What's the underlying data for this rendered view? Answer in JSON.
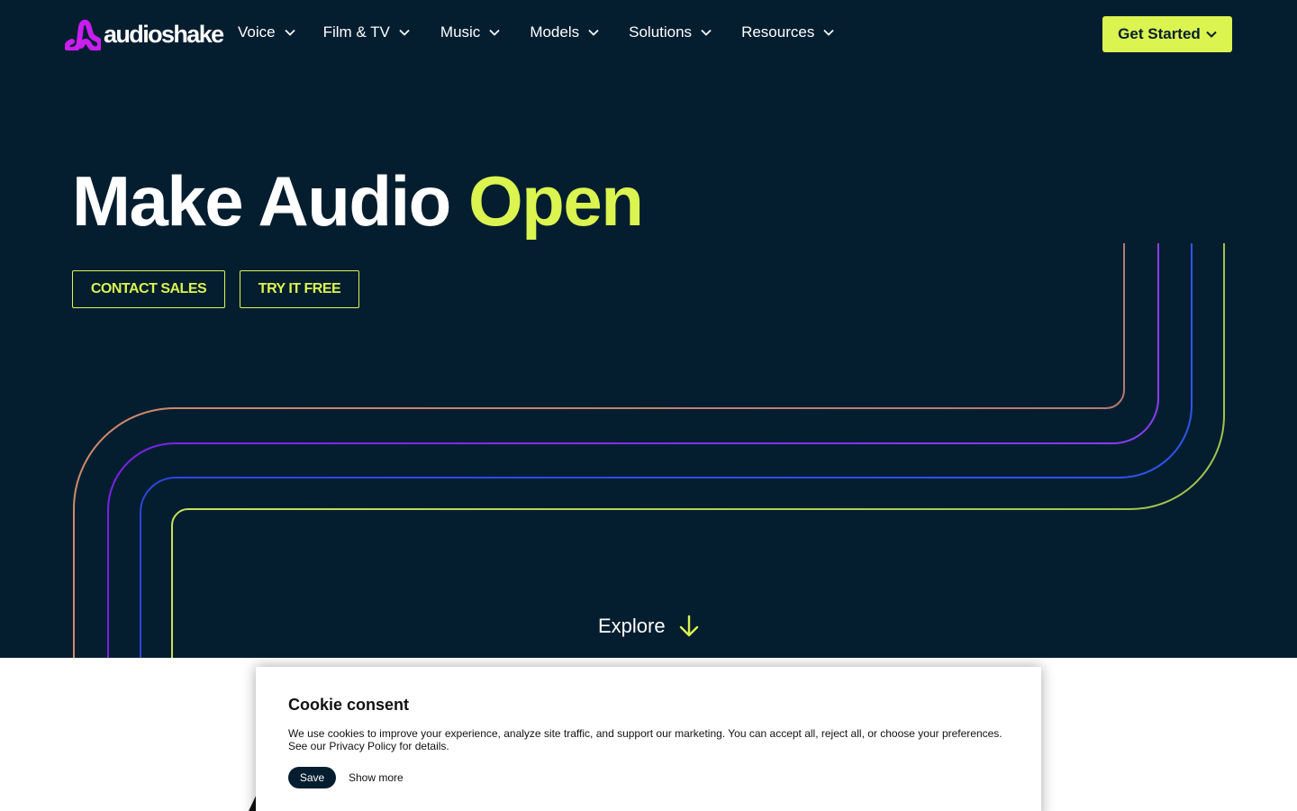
{
  "brand": {
    "name": "audioshake",
    "logo_icon": "audioshake-logo-icon",
    "logo_color": "#c81ef0"
  },
  "nav": {
    "items": [
      {
        "label": "Voice"
      },
      {
        "label": "Film & TV"
      },
      {
        "label": "Music"
      },
      {
        "label": "Models"
      },
      {
        "label": "Solutions"
      },
      {
        "label": "Resources"
      }
    ],
    "cta_label": "Get Started"
  },
  "hero": {
    "headline_main": "Make Audio",
    "headline_accent": "Open",
    "contact_label": "CONTACT SALES",
    "try_label": "TRY IT FREE",
    "explore_label": "Explore"
  },
  "cookie": {
    "title": "Cookie consent",
    "text": "We use cookies to improve your experience, analyze site traffic, and support our marketing. You can accept all, reject all, or choose your preferences. See our Privacy Policy for details.",
    "save_label": "Save",
    "more_label": "Show more"
  },
  "colors": {
    "background": "#041e30",
    "accent": "#dbf44f",
    "line_1": "#c9826e",
    "line_2": "#7a2ff0",
    "line_3": "#2b4ee8",
    "line_4": "#b6d24a"
  }
}
